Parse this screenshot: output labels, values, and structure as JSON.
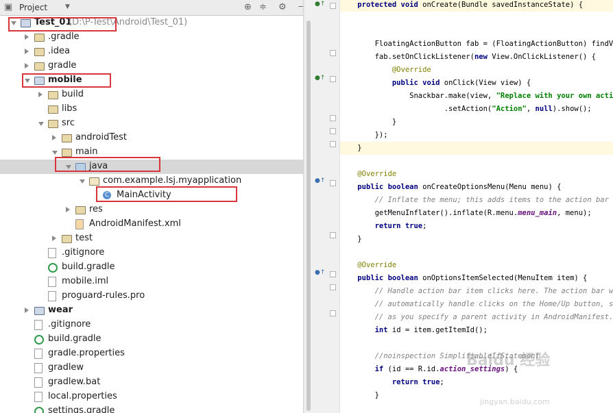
{
  "project_panel": {
    "view_selector": "Project",
    "tree": [
      {
        "label": "Test_01",
        "path": "(D:\\P-Test\\Android\\Test_01)",
        "bold": true
      },
      {
        "label": ".gradle"
      },
      {
        "label": ".idea"
      },
      {
        "label": "gradle"
      },
      {
        "label": "mobile",
        "bold": true
      },
      {
        "label": "build"
      },
      {
        "label": "libs"
      },
      {
        "label": "src"
      },
      {
        "label": "androidTest"
      },
      {
        "label": "main"
      },
      {
        "label": "java"
      },
      {
        "label": "com.example.lsj.myapplication"
      },
      {
        "label": "MainActivity"
      },
      {
        "label": "res"
      },
      {
        "label": "AndroidManifest.xml"
      },
      {
        "label": "test"
      },
      {
        "label": ".gitignore"
      },
      {
        "label": "build.gradle"
      },
      {
        "label": "mobile.iml"
      },
      {
        "label": "proguard-rules.pro"
      },
      {
        "label": "wear",
        "bold": true
      },
      {
        "label": ".gitignore"
      },
      {
        "label": "build.gradle"
      },
      {
        "label": "gradle.properties"
      },
      {
        "label": "gradlew"
      },
      {
        "label": "gradlew.bat"
      },
      {
        "label": "local.properties"
      },
      {
        "label": "settings.gradle"
      }
    ]
  },
  "editor": {
    "lines": [
      "    protected void onCreate(Bundle savedInstanceState) {",
      "",
      "        FloatingActionButton fab = (FloatingActionButton) findViewBy",
      "        fab.setOnClickListener(new View.OnClickListener() {",
      "            @Override",
      "            public void onClick(View view) {",
      "                Snackbar.make(view, \"Replace with your own acti",
      "                        .setAction(\"Action\", null).show();",
      "            }",
      "        });",
      "    }",
      "",
      "    @Override",
      "    public boolean onCreateOptionsMenu(Menu menu) {",
      "        // Inflate the menu; this adds items to the action bar if it",
      "        getMenuInflater().inflate(R.menu.menu_main, menu);",
      "        return true;",
      "    }",
      "",
      "    @Override",
      "    public boolean onOptionsItemSelected(MenuItem item) {",
      "        // Handle action bar item clicks here. The action bar will",
      "        // automatically handle clicks on the Home/Up button, so lon",
      "        // as you specify a parent activity in AndroidManifest.xml.",
      "        int id = item.getItemId();",
      "",
      "        //noinspection SimplifiableIfStatement",
      "        if (id == R.id.action_settings) {",
      "            return true;",
      "        }"
    ]
  },
  "watermark": {
    "text": "Baidu 经验",
    "sub": "jingyan.baidu.com"
  }
}
